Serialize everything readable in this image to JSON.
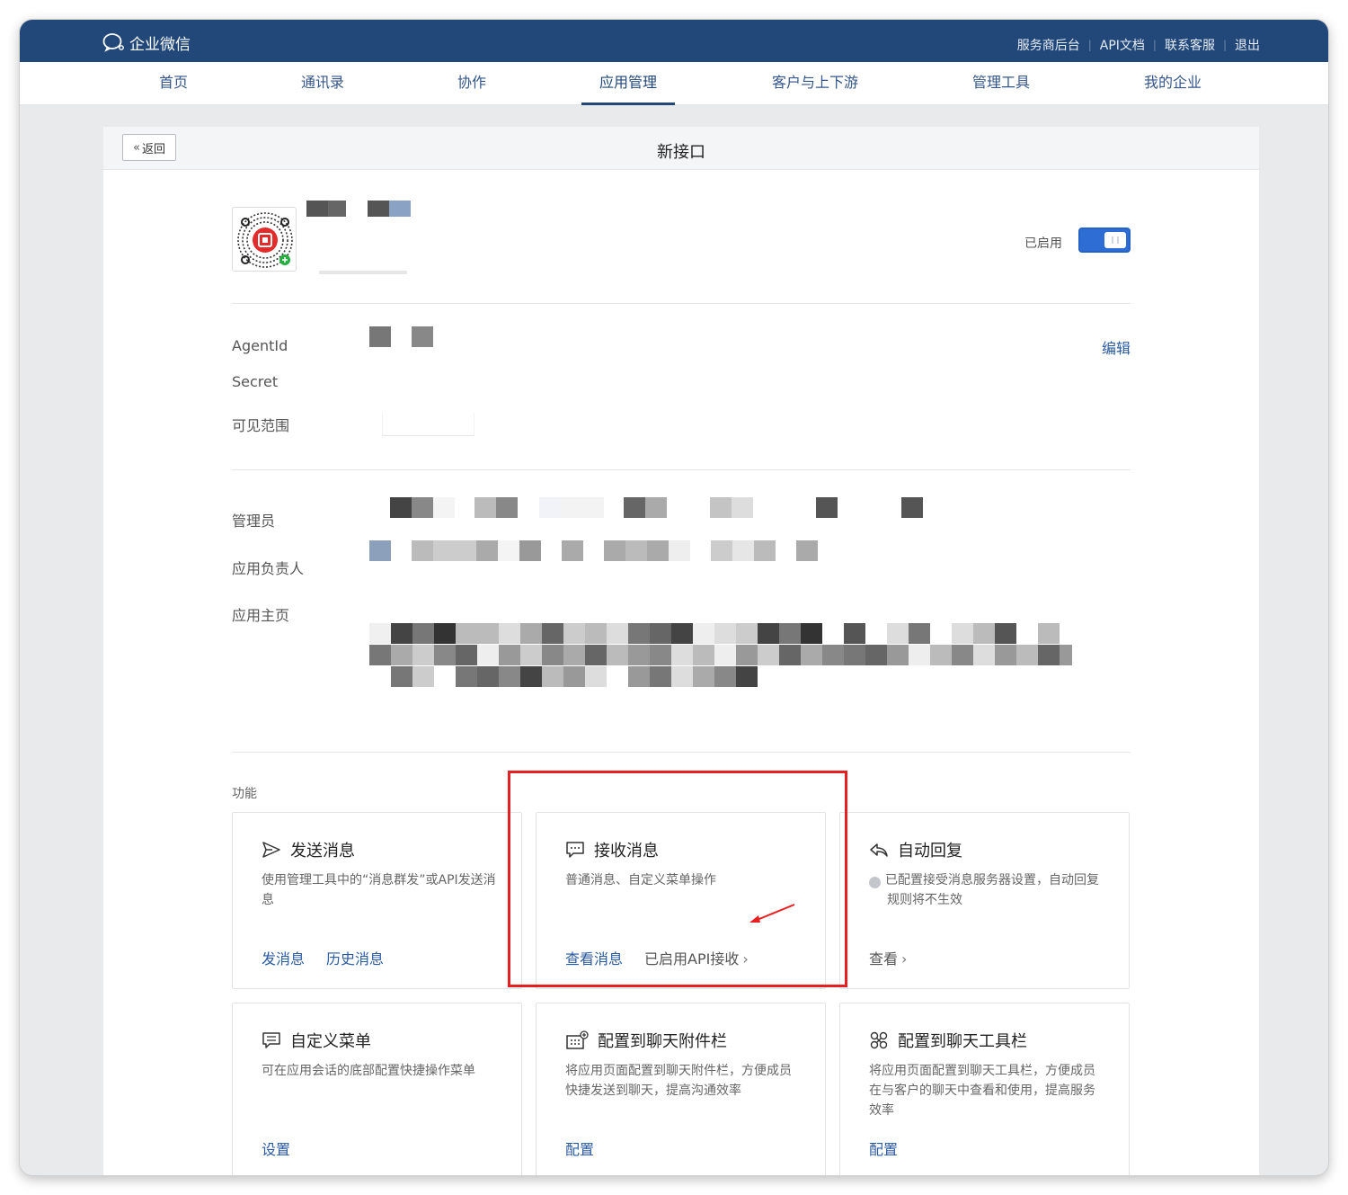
{
  "brand": {
    "name": "企业微信"
  },
  "toplinks": [
    "服务商后台",
    "API文档",
    "联系客服",
    "退出"
  ],
  "nav": {
    "tabs": [
      {
        "label": "首页",
        "active": false
      },
      {
        "label": "通讯录",
        "active": false
      },
      {
        "label": "协作",
        "active": false
      },
      {
        "label": "应用管理",
        "active": true
      },
      {
        "label": "客户与上下游",
        "active": false
      },
      {
        "label": "管理工具",
        "active": false
      },
      {
        "label": "我的企业",
        "active": false
      }
    ]
  },
  "header": {
    "back_label": "返回",
    "title": "新接口"
  },
  "app": {
    "status_label": "已启用",
    "enabled": true
  },
  "fields": {
    "agentid_label": "AgentId",
    "secret_label": "Secret",
    "scope_label": "可见范围",
    "edit_label": "编辑",
    "admin_label": "管理员",
    "owner_label": "应用负责人",
    "homepage_label": "应用主页"
  },
  "features": {
    "section_label": "功能",
    "cards": [
      {
        "title": "发送消息",
        "icon": "send-icon",
        "desc": "使用管理工具中的“消息群发”或API发送消息",
        "actions": [
          "发消息",
          "历史消息"
        ]
      },
      {
        "title": "接收消息",
        "icon": "message-icon",
        "desc": "普通消息、自定义菜单操作",
        "actions": [
          "查看消息"
        ],
        "status": "已启用API接收"
      },
      {
        "title": "自动回复",
        "icon": "reply-icon",
        "desc": "已配置接受消息服务器设置，自动回复规则将不生效",
        "actions": [
          "查看"
        ]
      },
      {
        "title": "自定义菜单",
        "icon": "menu-icon",
        "desc": "可在应用会话的底部配置快捷操作菜单",
        "actions": [
          "设置"
        ]
      },
      {
        "title": "配置到聊天附件栏",
        "icon": "attachment-bar-icon",
        "desc": "将应用页面配置到聊天附件栏，方便成员快捷发送到聊天，提高沟通效率",
        "actions": [
          "配置"
        ]
      },
      {
        "title": "配置到聊天工具栏",
        "icon": "toolbar-icon",
        "desc": "将应用页面配置到聊天工具栏，方便成员在与客户的聊天中查看和使用，提高服务效率",
        "actions": [
          "配置"
        ]
      }
    ]
  },
  "colors": {
    "topbar": "#22487a",
    "link": "#2a5aa0",
    "toggle": "#2e6ed4",
    "highlight": "#e62020"
  }
}
